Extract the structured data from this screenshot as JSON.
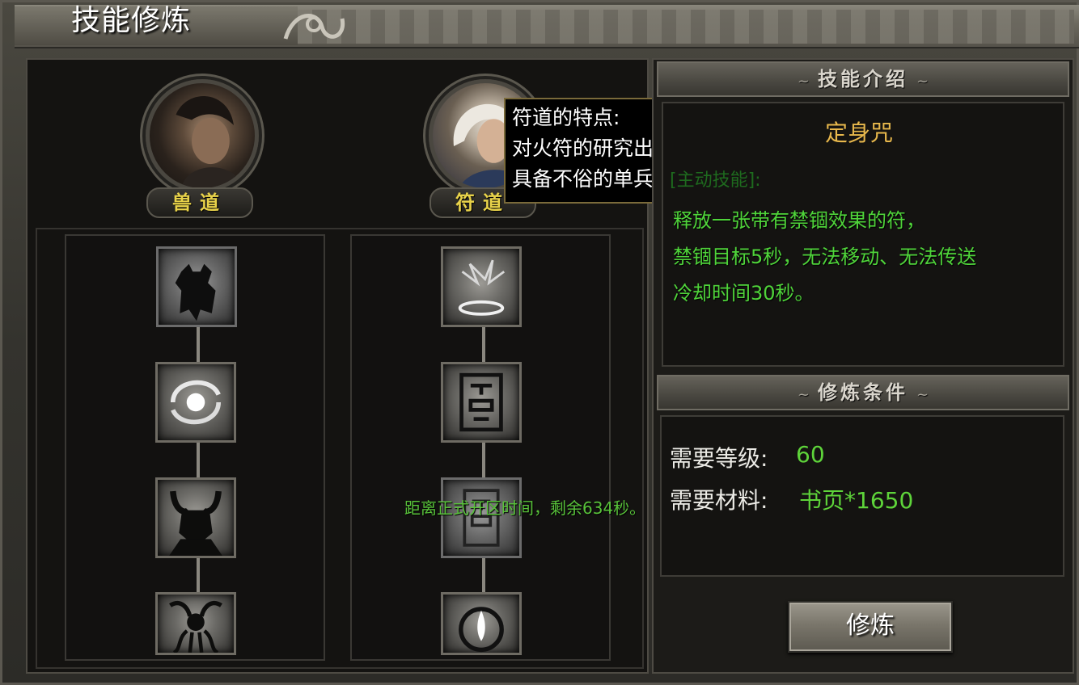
{
  "window": {
    "title": "技能修炼"
  },
  "paths": [
    {
      "name": "兽道",
      "portrait_icon": "warrior-portrait"
    },
    {
      "name": "符道",
      "portrait_icon": "taoist-portrait"
    }
  ],
  "tooltip": {
    "lines": [
      "符道的特点:",
      "对火符的研究出神入化。",
      "具备不俗的单兵作战能力。"
    ]
  },
  "countdown": "距离正式开区时间，剩余634秒。",
  "skill_trees": {
    "left": [
      "beast-warrior-icon",
      "vortex-orb-icon",
      "horned-helm-icon",
      "tentacle-idol-icon"
    ],
    "right": [
      "rune-circle-icon",
      "talisman-seal-icon",
      "talisman-seal-dim-icon",
      "soul-flame-icon"
    ]
  },
  "intro": {
    "header": "技能介绍",
    "skill_name": "定身咒",
    "ghost_label": "[主动技能]:",
    "description": [
      "释放一张带有禁锢效果的符，",
      "禁锢目标5秒，无法移动、无法传送",
      "冷却时间30秒。"
    ]
  },
  "conditions": {
    "header": "修炼条件",
    "level_label": "需要等级:",
    "level_value": "60",
    "material_label": "需要材料:",
    "material_value": "书页*1650"
  },
  "button": {
    "train_label": "修炼"
  },
  "colors": {
    "accent_gold": "#e8b84c",
    "text_green": "#4fd43a",
    "plate_yellow": "#e8d24a"
  }
}
